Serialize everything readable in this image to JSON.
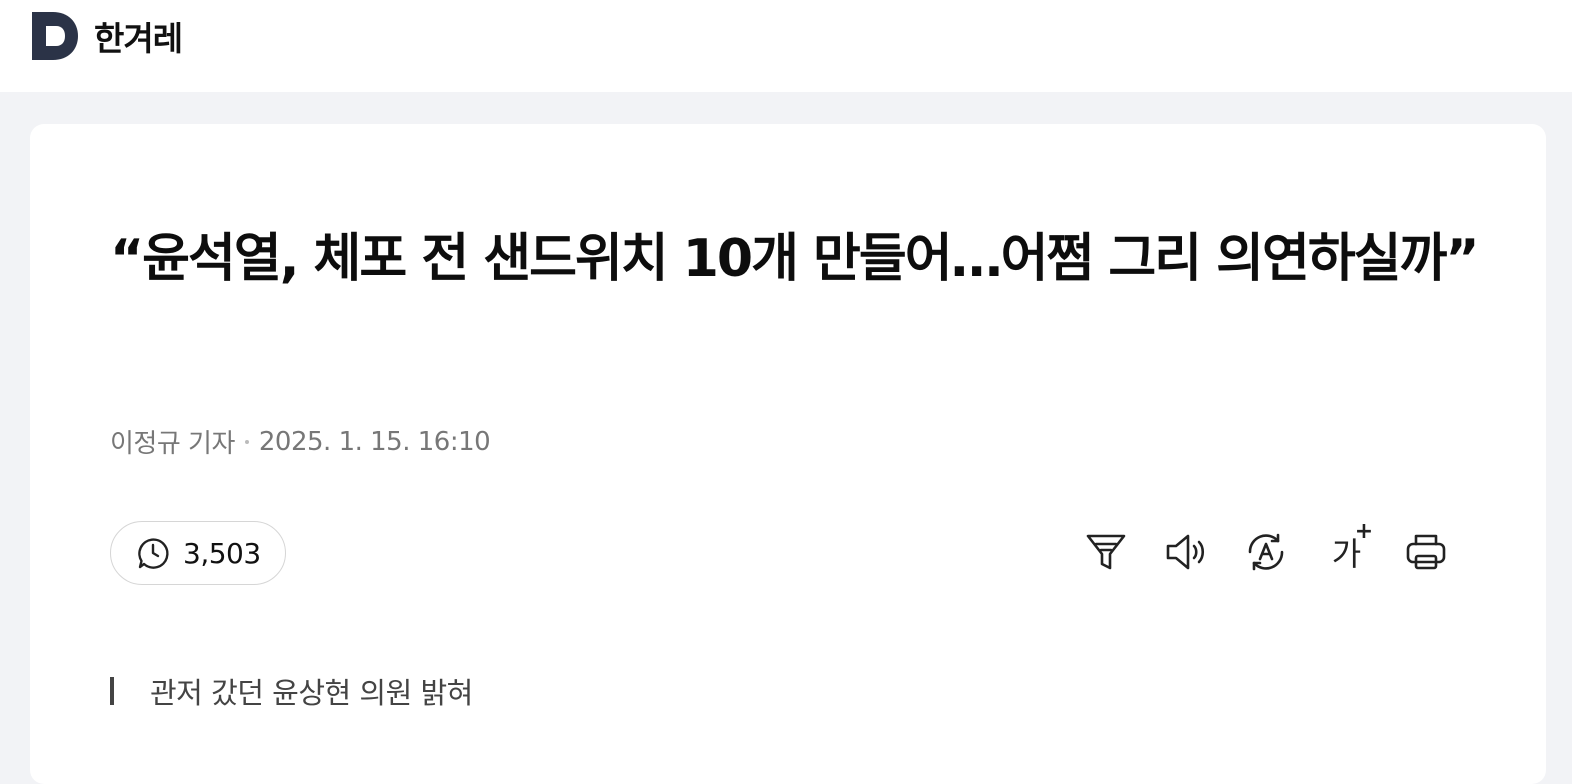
{
  "header": {
    "logo_letter": "D",
    "brand": "한겨레"
  },
  "article": {
    "headline": "“윤석열, 체포 전 샌드위치 10개 만들어…어쩜 그리 의연하실까”",
    "author": "이정규 기자",
    "datetime": "2025. 1. 15. 16:10",
    "comment_count": "3,503",
    "subheadline": "관저 갔던 윤상현 의원 밝혀"
  },
  "toolbar": {
    "font_size_label": "가",
    "font_size_plus": "+",
    "icons": [
      "filter-icon",
      "speaker-icon",
      "translate-icon",
      "font-size-icon",
      "print-icon"
    ]
  },
  "colors": {
    "page_bg": "#f2f3f6",
    "logo": "#2b3347",
    "text": "#111111",
    "muted": "#777777"
  }
}
